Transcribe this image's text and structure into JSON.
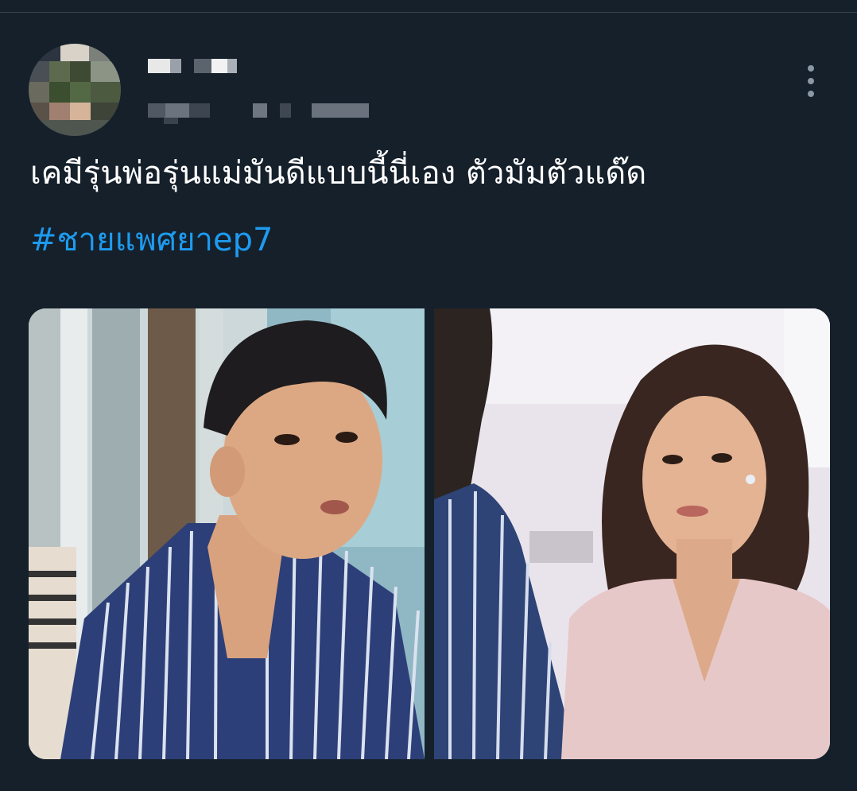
{
  "tweet": {
    "text": "เคมีรุ่นพ่อรุ่นแม่มันดีแบบนี้นี่เอง ตัวมัมตัวแด๊ด",
    "hashtag": "#ชายแพศยาep7"
  },
  "icons": {
    "more": "more-vertical-icon"
  },
  "colors": {
    "background": "#15202b",
    "text": "#ffffff",
    "hashtag": "#1d9bf0",
    "divider": "#38444d",
    "secondary": "#8b98a5"
  }
}
